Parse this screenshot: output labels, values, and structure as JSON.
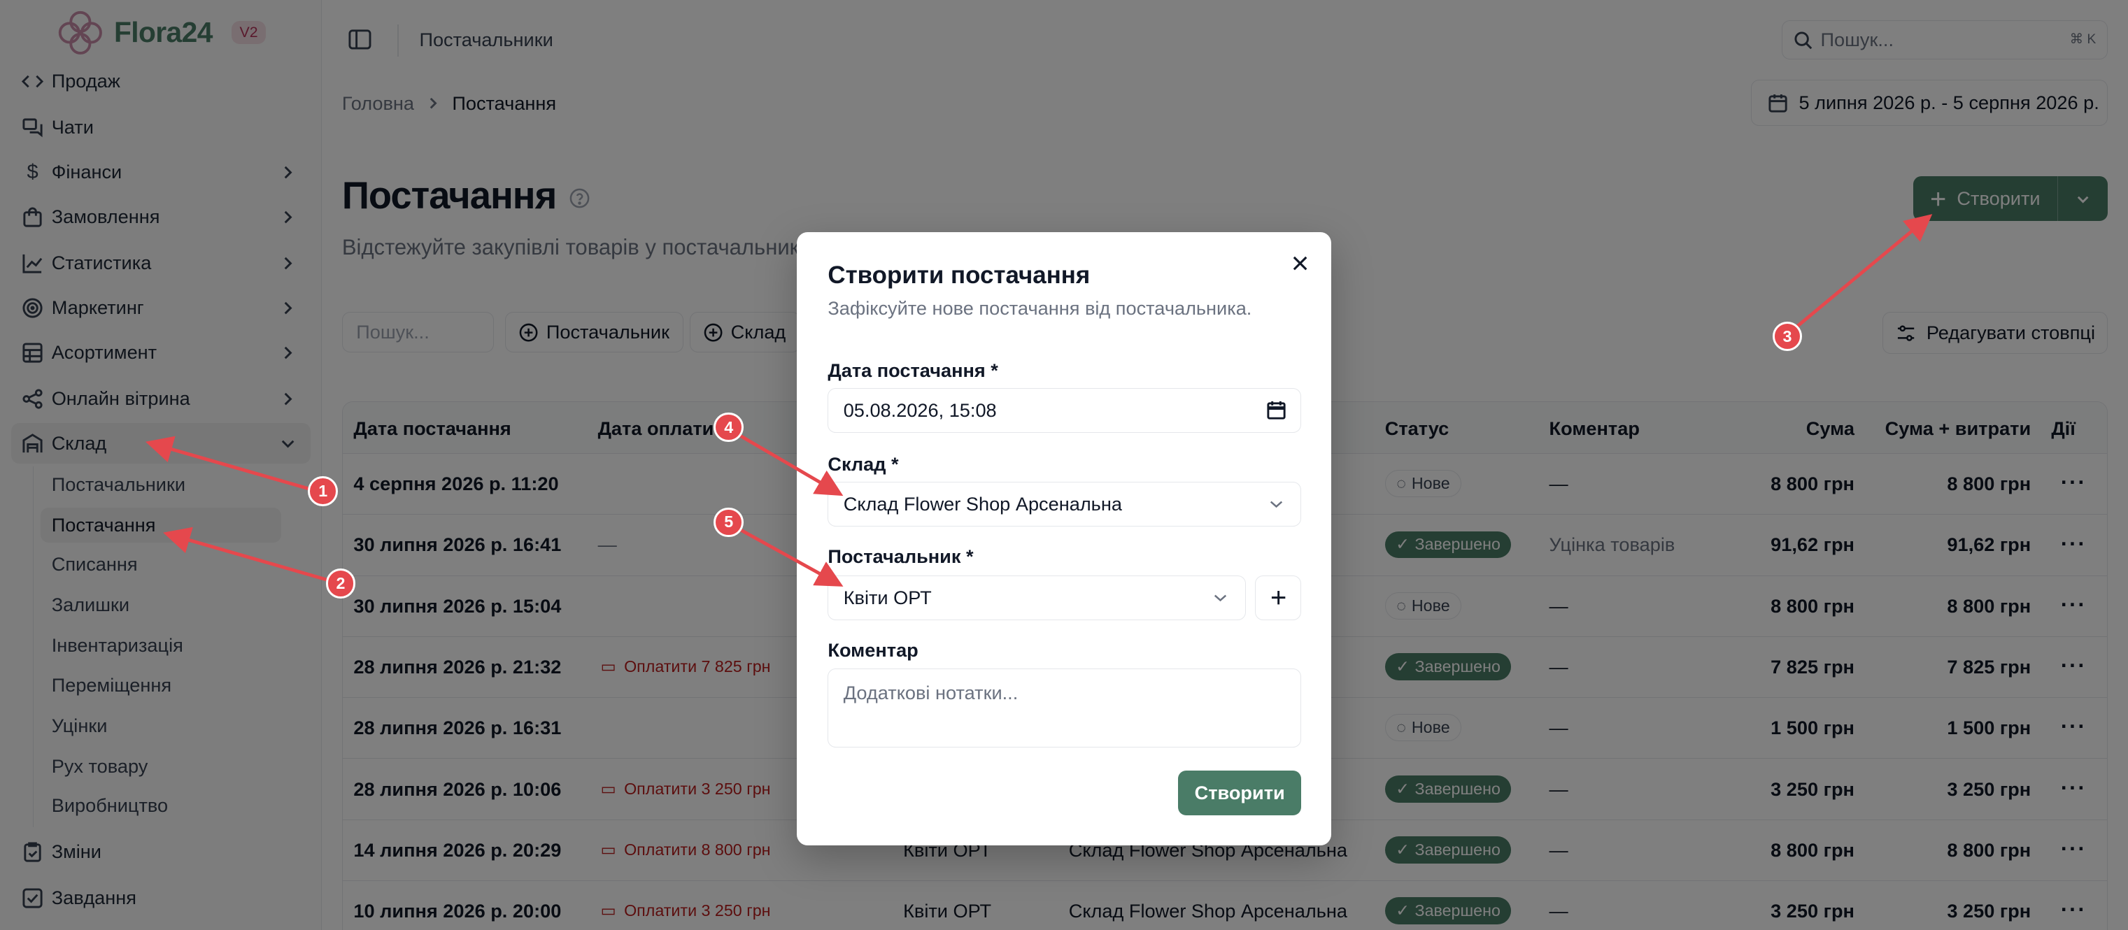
{
  "brand": {
    "name": "Flora24",
    "version": "V2"
  },
  "sidebar": {
    "items": [
      {
        "label": "Продаж",
        "icon": "code-icon"
      },
      {
        "label": "Чати",
        "icon": "chat-icon"
      },
      {
        "label": "Фінанси",
        "icon": "dollar-icon"
      },
      {
        "label": "Замовлення",
        "icon": "bag-icon"
      },
      {
        "label": "Статистика",
        "icon": "chart-line-icon"
      },
      {
        "label": "Маркетинг",
        "icon": "target-icon"
      },
      {
        "label": "Асортимент",
        "icon": "grid-icon"
      },
      {
        "label": "Онлайн вітрина",
        "icon": "share-icon"
      },
      {
        "label": "Склад",
        "icon": "warehouse-icon"
      },
      {
        "label": "Зміни",
        "icon": "clipboard-icon"
      },
      {
        "label": "Завдання",
        "icon": "checkbox-icon"
      }
    ],
    "sub_items": [
      "Постачальники",
      "Постачання",
      "Списання",
      "Залишки",
      "Інвентаризація",
      "Переміщення",
      "Уцінки",
      "Рух товару",
      "Виробництво"
    ]
  },
  "topbar": {
    "section": "Постачальники",
    "search_placeholder": "Пошук...",
    "shortcut": "⌘ K"
  },
  "breadcrumb": {
    "home": "Головна",
    "current": "Постачання"
  },
  "date_range": "5 липня 2026 р. - 5 серпня 2026 р.",
  "page": {
    "title": "Постачання",
    "subtitle": "Відстежуйте закупівлі товарів у постачальників",
    "create_label": "Створити"
  },
  "filters": {
    "search_placeholder": "Пошук...",
    "supplier_chip": "Постачальник",
    "warehouse_chip": "Склад",
    "edit_columns": "Редагувати стовпці"
  },
  "table": {
    "headers": {
      "date": "Дата постачання",
      "payment": "Дата оплати",
      "status": "Статус",
      "comment": "Коментар",
      "sum": "Сума",
      "sum_costs": "Сума + витрати",
      "actions": "Дії"
    },
    "rows": [
      {
        "date": "4 серпня 2026 р. 11:20",
        "payment": "",
        "supplier": "",
        "warehouse": "",
        "status": "Нове",
        "comment": "—",
        "sum": "8 800 грн",
        "sum_costs": "8 800 грн"
      },
      {
        "date": "30 липня 2026 р. 16:41",
        "payment": "—",
        "supplier": "",
        "warehouse": "",
        "status": "Завершено",
        "comment": "Уцінка товарів",
        "sum": "91,62 грн",
        "sum_costs": "91,62 грн"
      },
      {
        "date": "30 липня 2026 р. 15:04",
        "payment": "",
        "supplier": "",
        "warehouse": "",
        "status": "Нове",
        "comment": "—",
        "sum": "8 800 грн",
        "sum_costs": "8 800 грн"
      },
      {
        "date": "28 липня 2026 р. 21:32",
        "payment": "Оплатити 7 825 грн",
        "supplier": "",
        "warehouse": "",
        "status": "Завершено",
        "comment": "—",
        "sum": "7 825 грн",
        "sum_costs": "7 825 грн"
      },
      {
        "date": "28 липня 2026 р. 16:31",
        "payment": "",
        "supplier": "",
        "warehouse": "",
        "status": "Нове",
        "comment": "—",
        "sum": "1 500 грн",
        "sum_costs": "1 500 грн"
      },
      {
        "date": "28 липня 2026 р. 10:06",
        "payment": "Оплатити 3 250 грн",
        "supplier": "",
        "warehouse": "",
        "status": "Завершено",
        "comment": "—",
        "sum": "3 250 грн",
        "sum_costs": "3 250 грн"
      },
      {
        "date": "14 липня 2026 р. 20:29",
        "payment": "Оплатити 8 800 грн",
        "supplier": "Квіти ОРТ",
        "warehouse": "Склад Flower Shop Арсенальна",
        "status": "Завершено",
        "comment": "—",
        "sum": "8 800 грн",
        "sum_costs": "8 800 грн"
      },
      {
        "date": "10 липня 2026 р. 20:00",
        "payment": "Оплатити 3 250 грн",
        "supplier": "Квіти ОРТ",
        "warehouse": "Склад Flower Shop Арсенальна",
        "status": "Завершено",
        "comment": "—",
        "sum": "3 250 грн",
        "sum_costs": "3 250 грн"
      }
    ]
  },
  "modal": {
    "title": "Створити постачання",
    "subtitle": "Зафіксуйте нове постачання від постачальника.",
    "date_label": "Дата постачання *",
    "date_value": "05.08.2026, 15:08",
    "warehouse_label": "Склад *",
    "warehouse_value": "Склад Flower Shop Арсенальна",
    "supplier_label": "Постачальник *",
    "supplier_value": "Квіти ОРТ",
    "comment_label": "Коментар",
    "comment_placeholder": "Додаткові нотатки...",
    "submit": "Створити"
  },
  "annotations": [
    "1",
    "2",
    "3",
    "4",
    "5"
  ],
  "colors": {
    "accent": "#4a7c67",
    "danger": "#b91c1c",
    "annotation": "#e5484d"
  }
}
